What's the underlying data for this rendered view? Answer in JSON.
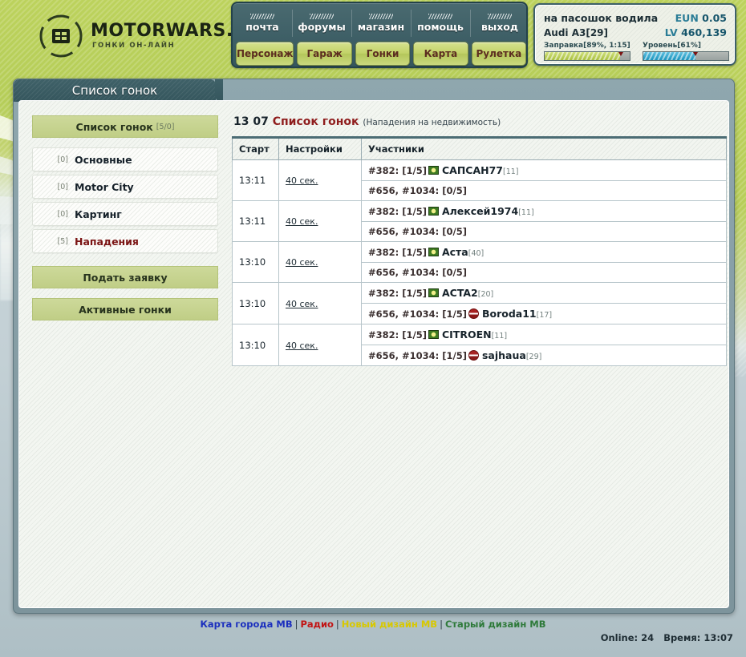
{
  "site": {
    "logo_name": "MOTORWARS.RU",
    "logo_tagline": "ГОНКИ ОН-ЛАЙН"
  },
  "nav": {
    "top": [
      {
        "label": "почта",
        "name": "nav-mail"
      },
      {
        "label": "форумы",
        "name": "nav-forums"
      },
      {
        "label": "магазин",
        "name": "nav-shop"
      },
      {
        "label": "помощь",
        "name": "nav-help"
      },
      {
        "label": "выход",
        "name": "nav-logout"
      }
    ],
    "bottom": [
      {
        "label": "Персонаж",
        "name": "nav-character"
      },
      {
        "label": "Гараж",
        "name": "nav-garage"
      },
      {
        "label": "Гонки",
        "name": "nav-races"
      },
      {
        "label": "Карта",
        "name": "nav-map"
      },
      {
        "label": "Рулетка",
        "name": "nav-roulette"
      }
    ]
  },
  "status": {
    "player_name": "на пасошок водила",
    "car": "Audi A3[29]",
    "currency_label": "EUN",
    "currency_value": "0.05",
    "level_label": "LV",
    "level_value": "460,139",
    "fuel_label": "Заправка[89%, 1:15]",
    "fuel_percent": 89,
    "exp_label": "Уровень[61%]",
    "exp_percent": 61,
    "fuel_color": "#a8bf3e",
    "exp_color": "#1a94bd"
  },
  "window": {
    "tab_title": "Список гонок"
  },
  "sidebar": {
    "header": {
      "label": "Список гонок",
      "count": "[5/0]"
    },
    "items": [
      {
        "num": "[0]",
        "label": "Основные",
        "highlight": false
      },
      {
        "num": "[0]",
        "label": "Motor City",
        "highlight": false
      },
      {
        "num": "[0]",
        "label": "Картинг",
        "highlight": false
      },
      {
        "num": "[5]",
        "label": "Нападения",
        "highlight": true
      }
    ],
    "actions": [
      {
        "label": "Подать заявку",
        "name": "submit-application-button"
      },
      {
        "label": "Активные гонки",
        "name": "active-races-button"
      }
    ]
  },
  "content": {
    "time": "13 07",
    "title": "Список гонок",
    "subtitle": "(Нападения на недвижимость)",
    "columns": [
      "Старт",
      "Настройки",
      "Участники"
    ],
    "rows": [
      {
        "start": "13:11",
        "settings": "40 сек.",
        "lines": [
          {
            "prefix": "#382: [1/5]",
            "icon": "green-target-icon",
            "player": "САПСАН77",
            "level": "[11]"
          },
          {
            "prefix": "#656, #1034: [0/5]",
            "icon": null,
            "player": "",
            "level": ""
          }
        ]
      },
      {
        "start": "13:11",
        "settings": "40 сек.",
        "lines": [
          {
            "prefix": "#382: [1/5]",
            "icon": "green-target-icon",
            "player": "Алексей1974",
            "level": "[11]"
          },
          {
            "prefix": "#656, #1034: [0/5]",
            "icon": null,
            "player": "",
            "level": ""
          }
        ]
      },
      {
        "start": "13:10",
        "settings": "40 сек.",
        "lines": [
          {
            "prefix": "#382: [1/5]",
            "icon": "green-target-icon",
            "player": "Аста",
            "level": "[40]"
          },
          {
            "prefix": "#656, #1034: [0/5]",
            "icon": null,
            "player": "",
            "level": ""
          }
        ]
      },
      {
        "start": "13:10",
        "settings": "40 сек.",
        "lines": [
          {
            "prefix": "#382: [1/5]",
            "icon": "green-target-icon",
            "player": "ACTA2",
            "level": "[20]"
          },
          {
            "prefix": "#656, #1034: [1/5]",
            "icon": "red-block-icon",
            "player": "Boroda11",
            "level": "[17]"
          }
        ]
      },
      {
        "start": "13:10",
        "settings": "40 сек.",
        "lines": [
          {
            "prefix": "#382: [1/5]",
            "icon": "green-target-icon",
            "player": "CITROEN",
            "level": "[11]"
          },
          {
            "prefix": "#656, #1034: [1/5]",
            "icon": "red-block-icon",
            "player": "sajhaua",
            "level": "[29]"
          }
        ]
      }
    ]
  },
  "footer": {
    "links": [
      {
        "label": "Карта города МВ",
        "color": "#1b2fbe"
      },
      {
        "label": "Радио",
        "color": "#c21414"
      },
      {
        "label": "Новый дизайн МВ",
        "color": "#d8c800"
      },
      {
        "label": "Старый дизайн МВ",
        "color": "#2e7a3a"
      }
    ],
    "separator": "|",
    "online_label": "Online:",
    "online_value": "24",
    "time_label": "Время:",
    "time_value": "13:07"
  }
}
